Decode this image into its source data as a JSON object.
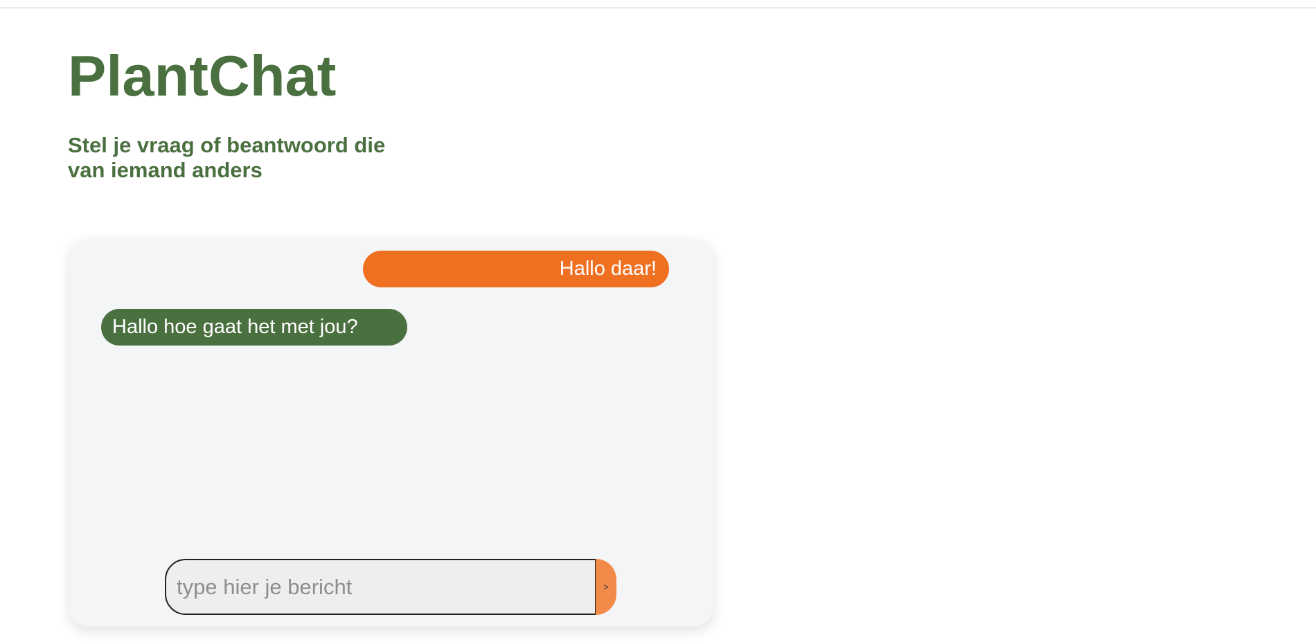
{
  "header": {
    "title": "PlantChat",
    "subtitle": "Stel je vraag of beantwoord die van iemand anders"
  },
  "chat": {
    "messages": [
      {
        "role": "sent",
        "text": "Hallo daar!"
      },
      {
        "role": "received",
        "text": "Hallo hoe gaat het met jou?"
      }
    ],
    "input": {
      "value": "",
      "placeholder": "type hier je bericht"
    },
    "send_label": ">"
  },
  "colors": {
    "brand_green": "#4b7040",
    "accent_orange": "#f07022",
    "send_button": "#f28a4a",
    "panel_bg": "#f4f5f7"
  }
}
